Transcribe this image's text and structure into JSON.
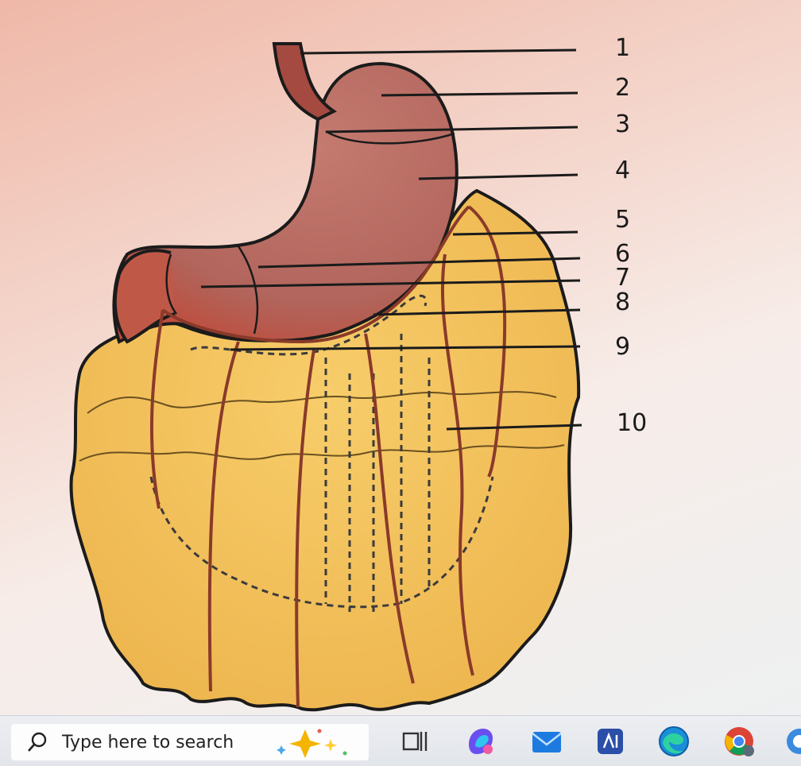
{
  "diagram": {
    "labels": [
      "1",
      "2",
      "3",
      "4",
      "5",
      "6",
      "7",
      "8",
      "9",
      "10"
    ]
  },
  "taskbar": {
    "search_placeholder": "Type here to search",
    "icons": [
      "copilot-sparkle-icon",
      "task-view-icon",
      "copilot-app-icon",
      "mail-icon",
      "app-icon",
      "edge-icon",
      "chrome-icon",
      "app-partial-icon"
    ]
  },
  "colors": {
    "stomach": "#b4635a",
    "omentum": "#f2c158",
    "vessel": "#8a3a2a",
    "taskbar": "#e6e8ec"
  }
}
